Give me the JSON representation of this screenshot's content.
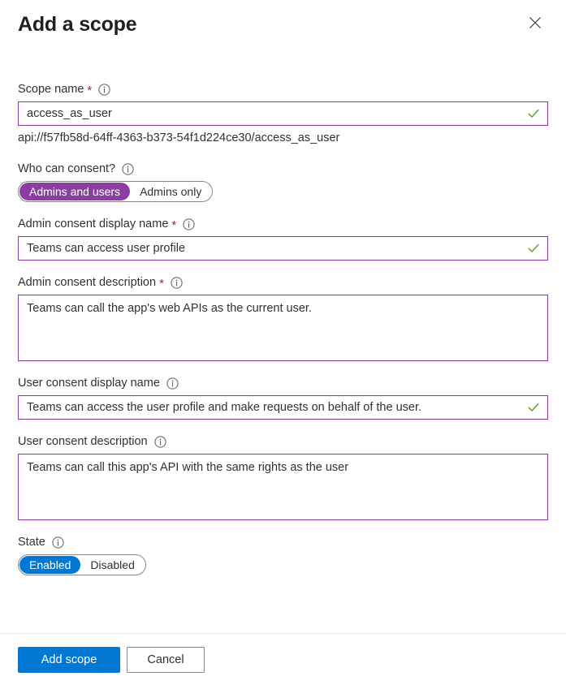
{
  "header": {
    "title": "Add a scope",
    "close_icon": "close-icon"
  },
  "fields": {
    "scope_name": {
      "label": "Scope name",
      "required": true,
      "info_icon": "info-icon",
      "value": "access_as_user",
      "placeholder": "",
      "valid": true,
      "helper_text": "api://f57fb58d-64ff-4363-b373-54f1d224ce30/access_as_user"
    },
    "who_can_consent": {
      "label": "Who can consent?",
      "required": false,
      "info_icon": "info-icon",
      "options": [
        "Admins and users",
        "Admins only"
      ],
      "selected": "Admins and users",
      "accent": "#8a3fa0"
    },
    "admin_consent_display_name": {
      "label": "Admin consent display name",
      "required": true,
      "info_icon": "info-icon",
      "value": "Teams can access user profile",
      "placeholder": "",
      "valid": true
    },
    "admin_consent_description": {
      "label": "Admin consent description",
      "required": true,
      "info_icon": "info-icon",
      "value": "Teams can call the app's web APIs as the current user.",
      "placeholder": ""
    },
    "user_consent_display_name": {
      "label": "User consent display name",
      "required": false,
      "info_icon": "info-icon",
      "value": "Teams can access the user profile and make requests on behalf of the user.",
      "placeholder": "",
      "valid": true
    },
    "user_consent_description": {
      "label": "User consent description",
      "required": false,
      "info_icon": "info-icon",
      "value": "Teams can call this app's API with the same rights as the user",
      "placeholder": ""
    },
    "state": {
      "label": "State",
      "required": false,
      "info_icon": "info-icon",
      "options": [
        "Enabled",
        "Disabled"
      ],
      "selected": "Enabled",
      "accent": "#0078d4"
    }
  },
  "footer": {
    "submit_label": "Add scope",
    "cancel_label": "Cancel"
  },
  "colors": {
    "input_border": "#8a3fa0",
    "primary_button": "#0078d4",
    "valid_check": "#5fa42b",
    "required_asterisk": "#a4262c"
  }
}
